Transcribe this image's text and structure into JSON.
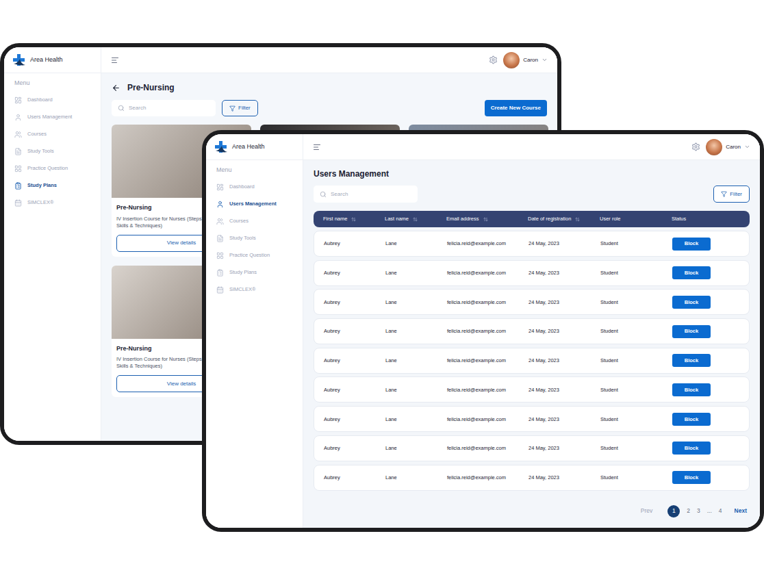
{
  "back_screen": {
    "brand": "Area Health",
    "menu_label": "Menu",
    "sidebar": {
      "items": [
        {
          "label": "Dashboard",
          "selected": false
        },
        {
          "label": "Users Management",
          "selected": false
        },
        {
          "label": "Courses",
          "selected": false
        },
        {
          "label": "Study Tools",
          "selected": false
        },
        {
          "label": "Practice Question",
          "selected": false
        },
        {
          "label": "Study Plans",
          "selected": true
        },
        {
          "label": "SIMCLEX®",
          "selected": false
        }
      ]
    },
    "user": {
      "name": "Caron"
    },
    "title": "Pre-Nursing",
    "search": {
      "placeholder": "Search"
    },
    "filter_button": "Filter",
    "create_button": "Create New Course",
    "cards": [
      {
        "kind": "course",
        "title": "Pre-Nursing",
        "description": "IV Insertion Course for Nurses (Steps, Skills & Techniques)",
        "button": "View details",
        "color": "#cfc9c3"
      },
      {
        "kind": "photo",
        "title": "",
        "description": "",
        "button": "",
        "color": "#2b2b2d"
      },
      {
        "kind": "photo",
        "title": "",
        "description": "",
        "button": "",
        "color": "#7d8ca0"
      },
      {
        "kind": "course",
        "title": "Pre-Nursing",
        "description": "IV Insertion Course for Nurses (Steps, Skills & Techniques)",
        "button": "View details",
        "color": "#d9d3cd"
      }
    ]
  },
  "front_screen": {
    "brand": "Area Health",
    "menu_label": "Menu",
    "sidebar": {
      "items": [
        {
          "label": "Dashboard",
          "selected": false
        },
        {
          "label": "Users Management",
          "selected": true
        },
        {
          "label": "Courses",
          "selected": false
        },
        {
          "label": "Study Tools",
          "selected": false
        },
        {
          "label": "Practice Question",
          "selected": false
        },
        {
          "label": "Study Plans",
          "selected": false
        },
        {
          "label": "SIMCLEX®",
          "selected": false
        }
      ]
    },
    "user": {
      "name": "Caron"
    },
    "title": "Users Management",
    "search": {
      "placeholder": "Search"
    },
    "filter_button": "Filter",
    "table": {
      "columns": [
        {
          "label": "First name",
          "sortable": true
        },
        {
          "label": "Last name",
          "sortable": true
        },
        {
          "label": "Email address",
          "sortable": true
        },
        {
          "label": "Date of registration",
          "sortable": true
        },
        {
          "label": "User role",
          "sortable": false
        },
        {
          "label": "Status",
          "sortable": false
        }
      ],
      "rows": [
        {
          "first_name": "Aubrey",
          "last_name": "Lane",
          "email": "felicia.reid@example.com",
          "date": "24 May, 2023",
          "role": "Student",
          "action": "Block"
        },
        {
          "first_name": "Aubrey",
          "last_name": "Lane",
          "email": "felicia.reid@example.com",
          "date": "24 May, 2023",
          "role": "Student",
          "action": "Block"
        },
        {
          "first_name": "Aubrey",
          "last_name": "Lane",
          "email": "felicia.reid@example.com",
          "date": "24 May, 2023",
          "role": "Student",
          "action": "Block"
        },
        {
          "first_name": "Aubrey",
          "last_name": "Lane",
          "email": "felicia.reid@example.com",
          "date": "24 May, 2023",
          "role": "Student",
          "action": "Block"
        },
        {
          "first_name": "Aubrey",
          "last_name": "Lane",
          "email": "felicia.reid@example.com",
          "date": "24 May, 2023",
          "role": "Student",
          "action": "Block"
        },
        {
          "first_name": "Aubrey",
          "last_name": "Lane",
          "email": "felicia.reid@example.com",
          "date": "24 May, 2023",
          "role": "Student",
          "action": "Block"
        },
        {
          "first_name": "Aubrey",
          "last_name": "Lane",
          "email": "felicia.reid@example.com",
          "date": "24 May, 2023",
          "role": "Student",
          "action": "Block"
        },
        {
          "first_name": "Aubrey",
          "last_name": "Lane",
          "email": "felicia.reid@example.com",
          "date": "24 May, 2023",
          "role": "Student",
          "action": "Block"
        },
        {
          "first_name": "Aubrey",
          "last_name": "Lane",
          "email": "felicia.reid@example.com",
          "date": "24 May, 2023",
          "role": "Student",
          "action": "Block"
        }
      ]
    },
    "pagination": {
      "prev": "Prev",
      "next": "Next",
      "pages": [
        {
          "label": "1",
          "selected": true
        },
        {
          "label": "2",
          "selected": false
        },
        {
          "label": "3",
          "selected": false
        },
        {
          "label": "...",
          "selected": false
        },
        {
          "label": "4",
          "selected": false
        }
      ]
    }
  }
}
